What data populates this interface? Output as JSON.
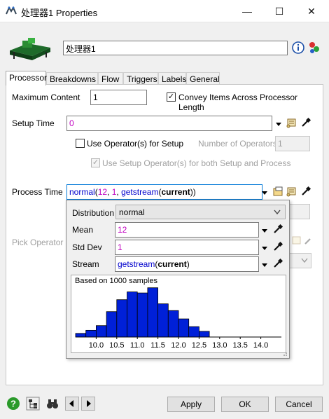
{
  "window": {
    "title": "处理器1  Properties",
    "minimize": "—",
    "maximize": "☐",
    "close": "✕"
  },
  "header": {
    "name_value": "处理器1"
  },
  "tabs": [
    "Processor",
    "Breakdowns",
    "Flow",
    "Triggers",
    "Labels",
    "General"
  ],
  "processor": {
    "max_content_label": "Maximum Content",
    "max_content_value": "1",
    "convey_label": "Convey Items Across Processor Length",
    "convey_checked": true,
    "setup_time_label": "Setup Time",
    "setup_time_value": "0",
    "use_operator_label": "Use Operator(s) for Setup",
    "use_operator_checked": false,
    "num_operators_label": "Number of Operators",
    "num_operators_value": "1",
    "use_setup_op_label": "Use Setup Operator(s) for both Setup and Process",
    "use_setup_op_checked": true,
    "process_time_label": "Process Time",
    "process_time_expr": {
      "fn": "normal",
      "open": "(",
      "arg1": "12",
      "sep1": ", ",
      "arg2": "1",
      "sep2": ", ",
      "fn2": "getstream",
      "open2": "(",
      "arg3": "current",
      "close": "))"
    },
    "pick_operator_label": "Pick Operator"
  },
  "distribution_popup": {
    "distribution_label": "Distribution",
    "distribution_value": "normal",
    "mean_label": "Mean",
    "mean_value": "12",
    "stddev_label": "Std Dev",
    "stddev_value": "1",
    "stream_label": "Stream",
    "stream_fn": "getstream",
    "stream_open": "(",
    "stream_arg": "current",
    "stream_close": ")"
  },
  "chart_data": {
    "type": "bar",
    "title": "Based on 1000 samples",
    "x_tick_labels": [
      "10.0",
      "10.5",
      "11.0",
      "11.5",
      "12.0",
      "12.5",
      "13.0",
      "13.5",
      "14.0"
    ],
    "x_range": [
      9.5,
      14.5
    ],
    "bins": [
      {
        "start": 9.5,
        "end": 9.75,
        "count": 7
      },
      {
        "start": 9.75,
        "end": 10.0,
        "count": 13
      },
      {
        "start": 10.0,
        "end": 10.25,
        "count": 22
      },
      {
        "start": 10.25,
        "end": 10.5,
        "count": 49
      },
      {
        "start": 10.5,
        "end": 10.75,
        "count": 72
      },
      {
        "start": 10.75,
        "end": 11.0,
        "count": 87
      },
      {
        "start": 11.0,
        "end": 11.25,
        "count": 85
      },
      {
        "start": 11.25,
        "end": 11.5,
        "count": 95
      },
      {
        "start": 11.5,
        "end": 11.75,
        "count": 64
      },
      {
        "start": 11.75,
        "end": 12.0,
        "count": 51
      },
      {
        "start": 12.0,
        "end": 12.25,
        "count": 35
      },
      {
        "start": 12.25,
        "end": 12.5,
        "count": 20
      },
      {
        "start": 12.5,
        "end": 12.75,
        "count": 11
      }
    ],
    "bar_color": "#0020d8",
    "y_max": 100
  },
  "buttons": {
    "apply": "Apply",
    "ok": "OK",
    "cancel": "Cancel"
  },
  "colors": {
    "string_literal": "#c000c0",
    "keyword": "#0000cc",
    "help": "#2a9a2a"
  }
}
